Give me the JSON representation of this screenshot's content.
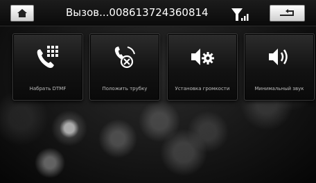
{
  "header": {
    "title": "Вызов...008613724360814",
    "home_icon": "home-icon",
    "signal_icon": "signal-strength-icon",
    "back_icon": "back-arrow-icon"
  },
  "tiles": [
    {
      "label": "Набрать DTMF",
      "icon": "dialpad-phone-icon"
    },
    {
      "label": "Положить трубку",
      "icon": "hang-up-icon"
    },
    {
      "label": "Установка громкости",
      "icon": "volume-settings-icon"
    },
    {
      "label": "Минимальный звук",
      "icon": "speaker-icon"
    }
  ],
  "colors": {
    "background": "#000000",
    "tile_label": "#bdbdbd",
    "title_text": "#ffffff"
  }
}
